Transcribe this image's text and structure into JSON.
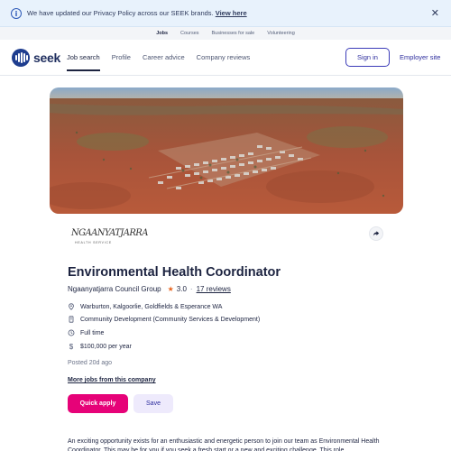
{
  "banner": {
    "message": "We have updated our Privacy Policy across our SEEK brands.",
    "link": "View here",
    "info_icon": "info-icon",
    "close_icon": "close-icon"
  },
  "subnav": {
    "items": [
      "Jobs",
      "Courses",
      "Businesses for sale",
      "Volunteering"
    ]
  },
  "header": {
    "logo_text": "seek",
    "nav": [
      "Job search",
      "Profile",
      "Career advice",
      "Company reviews"
    ],
    "sign_in": "Sign in",
    "employer_site": "Employer site"
  },
  "company_logo": {
    "line1": "NGAANYATJARRA",
    "line2": "HEALTH SERVICE"
  },
  "job": {
    "title": "Environmental Health Coordinator",
    "company": "Ngaanyatjarra Council Group",
    "rating": "3.0",
    "separator": "·",
    "reviews": "17 reviews",
    "location": "Warburton, Kalgoorlie, Goldfields & Esperance WA",
    "classification": "Community Development (Community Services & Development)",
    "work_type": "Full time",
    "salary": "$100,000 per year",
    "posted": "Posted 20d ago",
    "more_jobs": "More jobs from this company",
    "apply_label": "Quick apply",
    "save_label": "Save",
    "description": "An exciting opportunity exists for an enthusiastic and energetic person to join our team as Environmental Health Coordinator. This may be for you if you seek a fresh start or a new and exciting challenge. This role"
  },
  "colors": {
    "brand_navy": "#1e3d8f",
    "accent_pink": "#e60278",
    "link_indigo": "#2e2e9e",
    "star": "#e8651f"
  }
}
